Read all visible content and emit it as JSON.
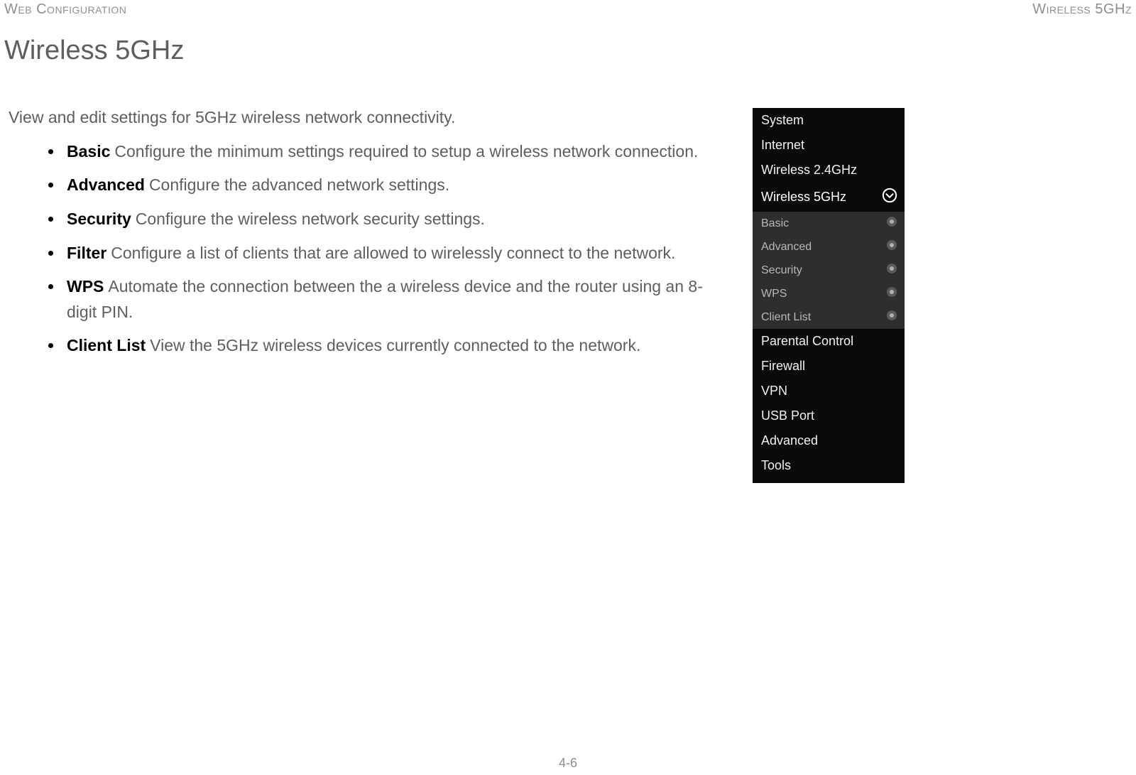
{
  "header": {
    "left": "Web Configuration",
    "right": "Wireless 5GHz"
  },
  "title": "Wireless 5GHz",
  "intro": "View and edit settings for 5GHz wireless network connectivity.",
  "bullets": [
    {
      "term": "Basic",
      "desc": "Configure the minimum settings required to setup a wireless network connection."
    },
    {
      "term": "Advanced",
      "desc": "Configure the advanced network settings."
    },
    {
      "term": "Security",
      "desc": "Configure the wireless network security settings."
    },
    {
      "term": "Filter",
      "desc": "Configure a list of clients that are allowed to wirelessly connect to the network."
    },
    {
      "term": "WPS",
      "desc": "Automate the connection between the a wireless device and the router using an 8-digit PIN."
    },
    {
      "term": "Client List",
      "desc": "View the 5GHz wireless devices currently connected to the network."
    }
  ],
  "sidebar": {
    "items": [
      {
        "label": "System",
        "expanded": false
      },
      {
        "label": "Internet",
        "expanded": false
      },
      {
        "label": "Wireless 2.4GHz",
        "expanded": false
      },
      {
        "label": "Wireless 5GHz",
        "expanded": true,
        "sub": [
          {
            "label": "Basic"
          },
          {
            "label": "Advanced"
          },
          {
            "label": "Security"
          },
          {
            "label": "WPS"
          },
          {
            "label": "Client List"
          }
        ]
      },
      {
        "label": "Parental Control",
        "expanded": false
      },
      {
        "label": "Firewall",
        "expanded": false
      },
      {
        "label": "VPN",
        "expanded": false
      },
      {
        "label": "USB Port",
        "expanded": false
      },
      {
        "label": "Advanced",
        "expanded": false
      },
      {
        "label": "Tools",
        "expanded": false
      }
    ]
  },
  "page_number": "4-6"
}
